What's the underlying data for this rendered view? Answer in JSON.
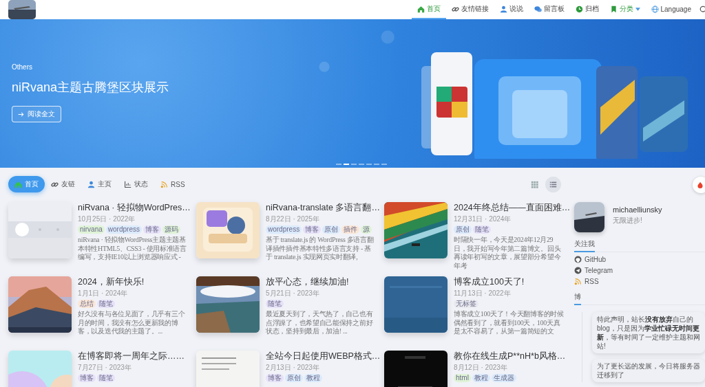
{
  "nav": {
    "items": [
      {
        "label": "首页",
        "kind": "link",
        "selected": true
      },
      {
        "label": "友情链接",
        "kind": "link",
        "selected": false
      },
      {
        "label": "说说",
        "kind": "link",
        "selected": false
      },
      {
        "label": "留言板",
        "kind": "link",
        "selected": false
      },
      {
        "label": "归档",
        "kind": "link",
        "selected": false
      },
      {
        "label": "分类",
        "kind": "dropdown",
        "selected": false
      },
      {
        "label": "Language",
        "kind": "link",
        "selected": false
      }
    ]
  },
  "hero": {
    "category": "Others",
    "title": "niRvana主题古腾堡区块展示",
    "button": "阅读全文",
    "slides": [
      {
        "selected": false
      },
      {
        "selected": true
      },
      {
        "selected": false
      },
      {
        "selected": false
      },
      {
        "selected": false
      },
      {
        "selected": false
      },
      {
        "selected": false
      }
    ]
  },
  "filter_tabs": [
    {
      "label": "首页",
      "selected": true
    },
    {
      "label": "友链",
      "selected": false
    },
    {
      "label": "主页",
      "selected": false
    },
    {
      "label": "状态",
      "selected": false
    },
    {
      "label": "RSS",
      "selected": false
    }
  ],
  "view_toggle": [
    {
      "kind": "grid",
      "selected": false
    },
    {
      "kind": "list",
      "selected": true
    }
  ],
  "posts": [
    {
      "title": "niRvana · 轻拟物WordPres…",
      "date": "10月25日 · 2022年",
      "tags": [
        {
          "label": "nirvana",
          "color": "#dff3d6"
        },
        {
          "label": "wordpress",
          "color": "#dbeafb"
        },
        {
          "label": "博客",
          "color": "#e6e1f8"
        },
        {
          "label": "源码",
          "color": "#dff3d6"
        }
      ],
      "excerpt": "niRvana · 轻拟物WordPress主题主题基本特性HTML5、CSS3 - 使用标准语言编写，支持IE10以上浏览器响应式 -"
    },
    {
      "title": "niRvana-translate 多语言翻…",
      "date": "8月22日 · 2025年",
      "tags": [
        {
          "label": "wordpress",
          "color": "#dbeafb"
        },
        {
          "label": "博客",
          "color": "#e6e1f8"
        },
        {
          "label": "原创",
          "color": "#dbeafb"
        },
        {
          "label": "插件",
          "color": "#fbe6d6"
        },
        {
          "label": "源",
          "color": "#dff3d6"
        }
      ],
      "excerpt": "基于 translate.js 的 WordPress 多语言翻译插件插件基本特性多语言支持 - 基于 translate.js 实现网页实时翻译,"
    },
    {
      "title": "2024年终总结——直面困难…",
      "date": "12月31日 · 2024年",
      "tags": [
        {
          "label": "原创",
          "color": "#dbeafb"
        },
        {
          "label": "随笔",
          "color": "#e6e1f8"
        }
      ],
      "excerpt": "时隔快一年，今天是2024年12月29日，我开始写今年第二篇博文。回头再读年初写的文章，展望部分希望今年考"
    },
    {
      "title": "2024，新年快乐!",
      "date": "1月1日 · 2024年",
      "tags": [
        {
          "label": "总结",
          "color": "#fbe6d6"
        },
        {
          "label": "随笔",
          "color": "#e6e1f8"
        }
      ],
      "excerpt": "好久没有与各位见面了，几乎有三个月的时间，我没有怎么更新我的博客，以及迭代我的主题了。..."
    },
    {
      "title": "放平心态，继续加油!",
      "date": "5月21日 · 2023年",
      "tags": [
        {
          "label": "随笔",
          "color": "#e6e1f8"
        }
      ],
      "excerpt": "最近夏天到了，天气热了，自己也有点浮躁了，也希望自己能保持之前好状态，坚持到最后，加油! ..."
    },
    {
      "title": "博客成立100天了!",
      "date": "11月13日 · 2022年",
      "tags": [
        {
          "label": "无标签",
          "color": "#e9eaee"
        }
      ],
      "excerpt": "博客成立100天了！今天翻博客的时候偶然看到了，就看到100天，100天真是太不容易了，从第一篇简短的文"
    },
    {
      "title": "在博客即将一周年之际……",
      "date": "7月27日 · 2023年",
      "tags": [
        {
          "label": "博客",
          "color": "#e6e1f8"
        },
        {
          "label": "随笔",
          "color": "#e6e1f8"
        }
      ]
    },
    {
      "title": "全站今日起使用WEBP格式…",
      "date": "2月13日 · 2023年",
      "tags": [
        {
          "label": "博客",
          "color": "#e6e1f8"
        },
        {
          "label": "原创",
          "color": "#dbeafb"
        },
        {
          "label": "教程",
          "color": "#dbeafb"
        }
      ]
    },
    {
      "title": "教你在线生成P**nH*b风格…",
      "date": "8月12日 · 2023年",
      "tags": [
        {
          "label": "html",
          "color": "#dff3d6"
        },
        {
          "label": "教程",
          "color": "#dbeafb"
        },
        {
          "label": "生成器",
          "color": "#dbeafb"
        }
      ]
    }
  ],
  "sidebar": {
    "profile": {
      "name": "michaelliunsky",
      "motto": "无限进步!"
    },
    "follow": {
      "heading": "关注我",
      "links": [
        "GitHub",
        "Telegram",
        "RSS"
      ]
    },
    "notes": {
      "heading": "博",
      "items": [
        "特此声明，站长**没有放弃**自己的blog，只是因为**学业忙碌无时间更新**，等有时间了一定维护主题和网站!",
        "为了更长远的发展，今日将服务器迁移到了"
      ]
    }
  }
}
